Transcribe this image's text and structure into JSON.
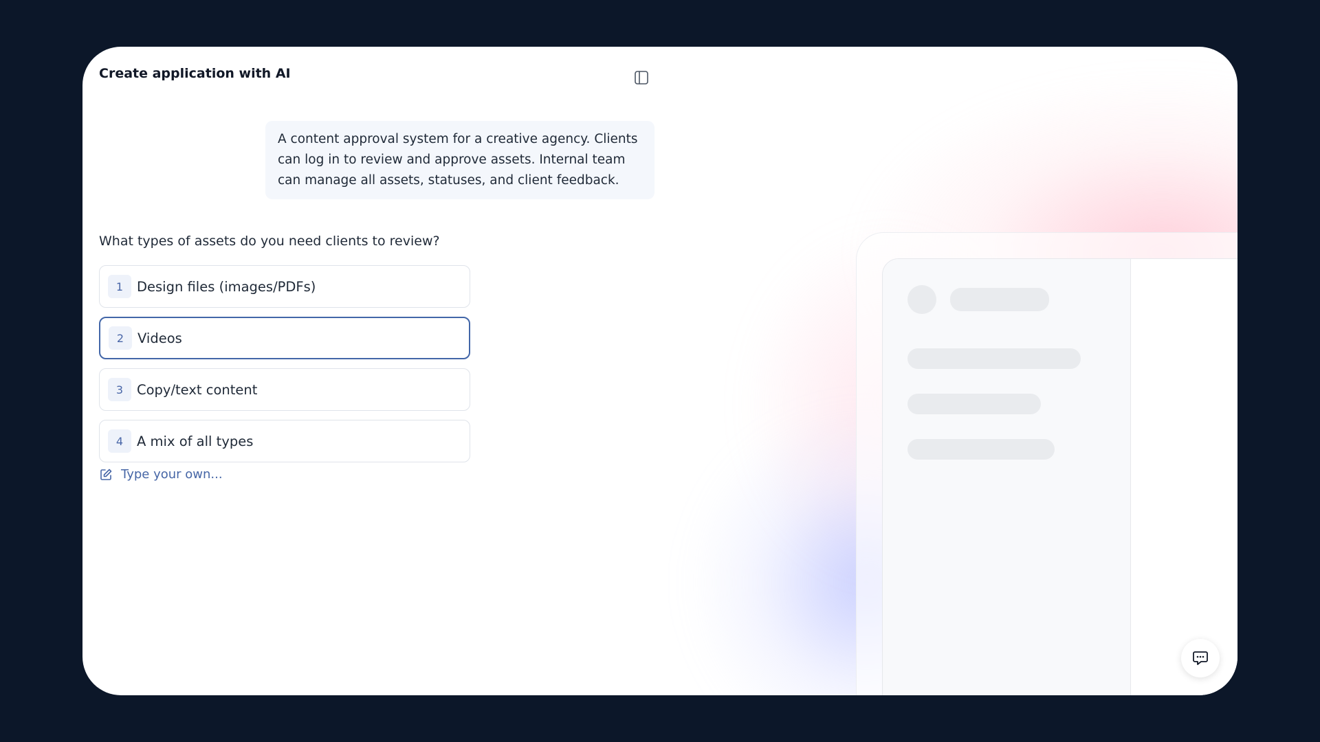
{
  "header": {
    "title": "Create application with AI",
    "panel_toggle_icon": "sidebar-panel-icon"
  },
  "conversation": {
    "user_message": "A content approval system for a creative agency. Clients can log in to review and approve assets. Internal team can manage all assets, statuses, and client feedback.",
    "question": "What types of assets do you need clients to review?",
    "options": [
      {
        "number": "1",
        "label": "Design files (images/PDFs)",
        "selected": false
      },
      {
        "number": "2",
        "label": "Videos",
        "selected": true
      },
      {
        "number": "3",
        "label": "Copy/text content",
        "selected": false
      },
      {
        "number": "4",
        "label": "A mix of all types",
        "selected": false
      }
    ],
    "custom_answer_label": "Type your own...",
    "custom_answer_icon": "edit-icon"
  },
  "chat_button": {
    "icon": "chat-icon"
  },
  "colors": {
    "background": "#0c1729",
    "accent": "#4266a8",
    "selected_border": "#4266a8"
  }
}
